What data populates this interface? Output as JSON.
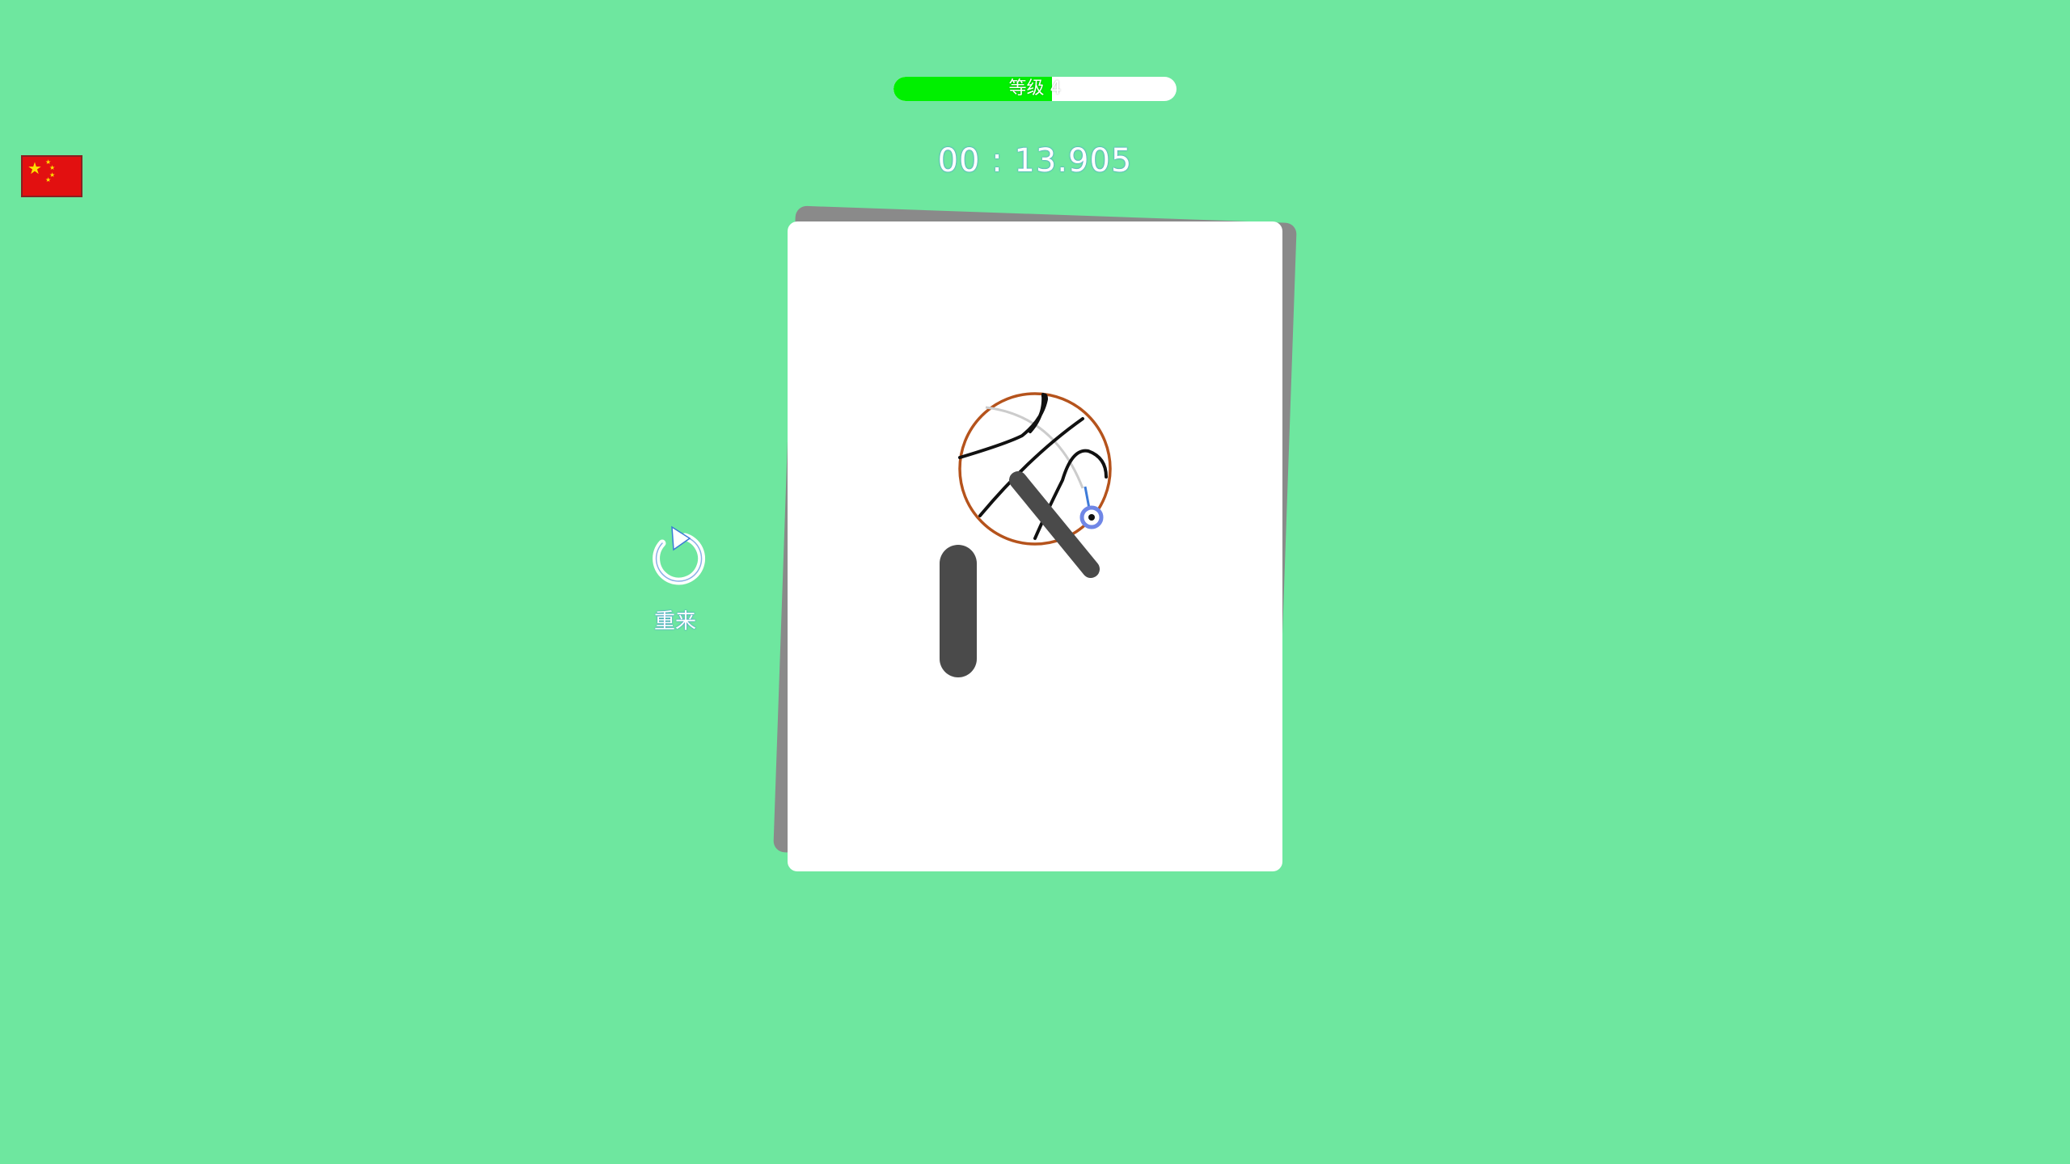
{
  "hud": {
    "level_label": "等级 4",
    "level_progress": 0.56,
    "timer": "00 : 13.905"
  },
  "language": {
    "flag": "china-flag"
  },
  "restart": {
    "icon": "restart-icon",
    "label": "重来"
  },
  "colors": {
    "background": "#6ee79f",
    "progress_fill": "#00f000",
    "paper": "#ffffff",
    "ball_outline": "#b5531c",
    "obstacle": "#4a4a4a",
    "pin_ring": "#6f86e6"
  }
}
